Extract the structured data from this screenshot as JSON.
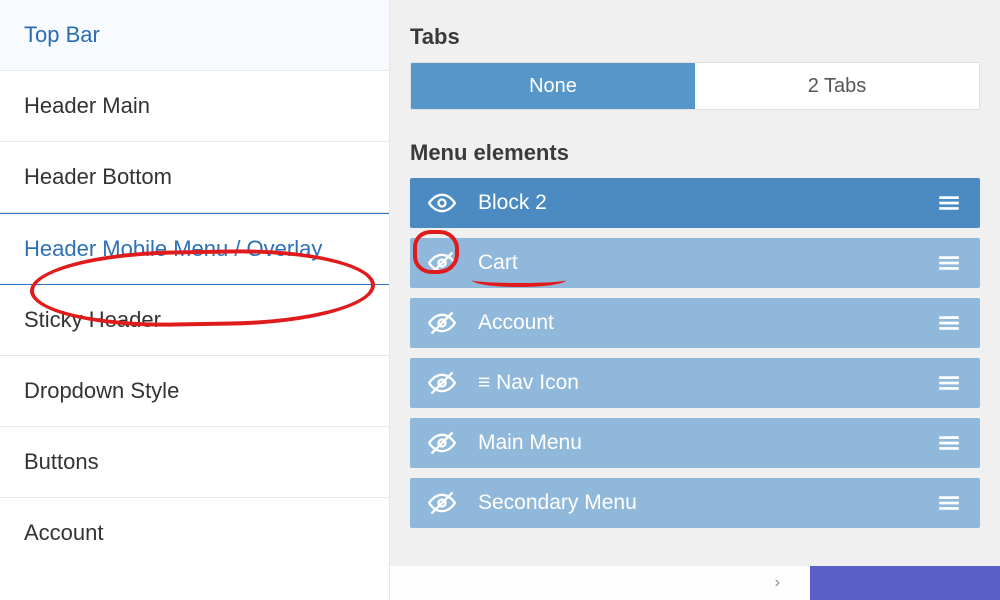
{
  "sidebar": {
    "items": [
      {
        "label": "Top Bar",
        "accent": true
      },
      {
        "label": "Header Main"
      },
      {
        "label": "Header Bottom"
      },
      {
        "label": "Header Mobile Menu / Overlay",
        "selected": true
      },
      {
        "label": "Sticky Header"
      },
      {
        "label": "Dropdown Style"
      },
      {
        "label": "Buttons"
      },
      {
        "label": "Account"
      }
    ]
  },
  "tabs": {
    "heading": "Tabs",
    "options": [
      "None",
      "2 Tabs"
    ],
    "active": 0
  },
  "menu_elements": {
    "heading": "Menu elements",
    "items": [
      {
        "label": "Block 2",
        "visible": true,
        "active": true
      },
      {
        "label": "Cart",
        "visible": false
      },
      {
        "label": "Account",
        "visible": false
      },
      {
        "label": "≡ Nav Icon",
        "visible": false
      },
      {
        "label": "Main Menu",
        "visible": false
      },
      {
        "label": "Secondary Menu",
        "visible": false
      }
    ]
  },
  "bottom": {
    "arrow": "›"
  }
}
